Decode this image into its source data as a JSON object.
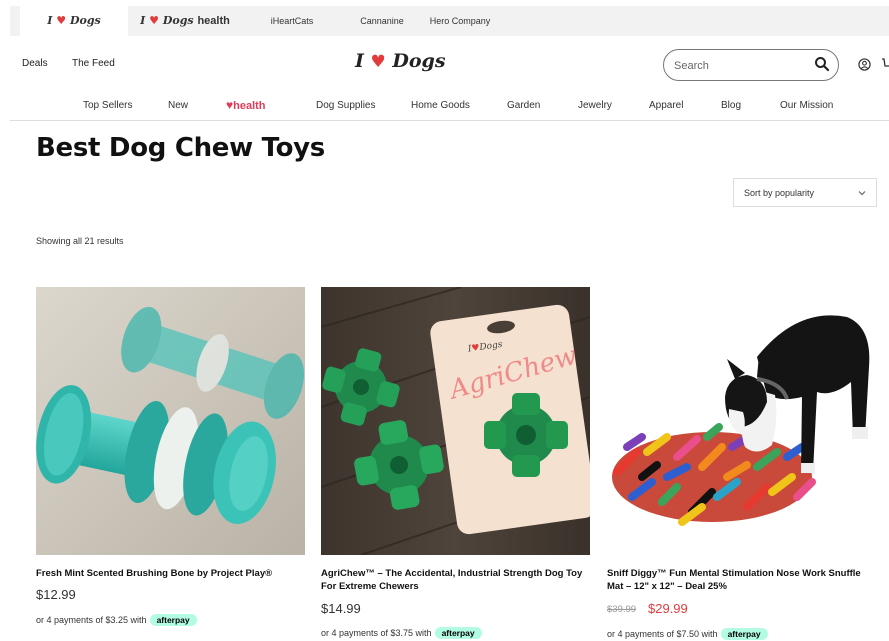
{
  "brand_tabs": [
    {
      "label": "I",
      "label2": "Dogs"
    },
    {
      "label": "I",
      "label2": "Dogs",
      "label3": "health"
    },
    {
      "label": "iHeartCats"
    },
    {
      "label": "Cannanine"
    },
    {
      "label": "Hero Company"
    }
  ],
  "header": {
    "deals": "Deals",
    "feed": "The Feed",
    "logo_i": "I",
    "logo_dogs": "Dogs",
    "search_placeholder": "Search"
  },
  "nav": {
    "top_sellers": "Top Sellers",
    "new": "New",
    "health": "health",
    "dog_supplies": "Dog Supplies",
    "home_goods": "Home Goods",
    "garden": "Garden",
    "jewelry": "Jewelry",
    "apparel": "Apparel",
    "blog": "Blog",
    "mission": "Our Mission"
  },
  "page": {
    "title": "Best Dog Chew Toys",
    "sort_label": "Sort by popularity",
    "results": "Showing all 21 results"
  },
  "products": [
    {
      "title": "Fresh Mint Scented Brushing Bone by Project Play®",
      "price": "$12.99",
      "afterpay": "or 4 payments of $3.25 with"
    },
    {
      "title": "AgriChew™ – The Accidental, Industrial Strength Dog Toy For Extreme Chewers",
      "price": "$14.99",
      "afterpay": "or 4 payments of $3.75 with",
      "package_text": "AgriChew",
      "package_brand_i": "I",
      "package_brand_dogs": "Dogs"
    },
    {
      "title": "Sniff Diggy™ Fun Mental Stimulation Nose Work Snuffle Mat – 12\" x 12\" – Deal 25%",
      "old_price": "$39.99",
      "price": "$29.99",
      "afterpay": "or 4 payments of $7.50 with"
    }
  ],
  "afterpay_label": "afterpay",
  "colors": {
    "brand_red": "#e23b3b",
    "afterpay_mint": "#b2fce4",
    "toy_teal": "#3cc3b8",
    "agrichew_green": "#1f8a4c"
  },
  "icons": [
    "search-icon",
    "user-icon",
    "cart-icon",
    "chevron-down-icon",
    "heart-icon"
  ]
}
